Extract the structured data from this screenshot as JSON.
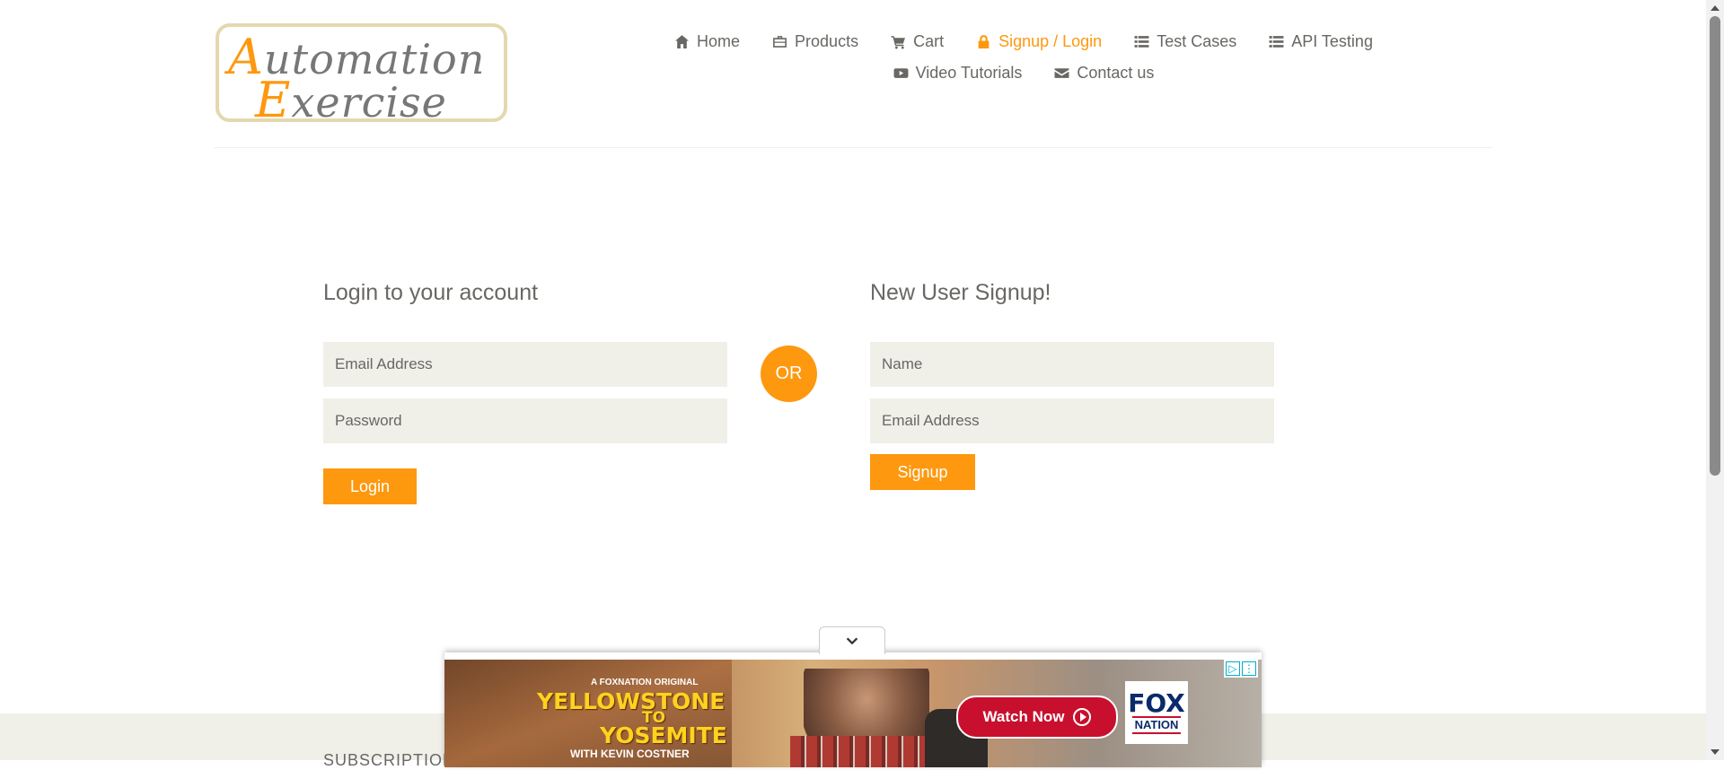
{
  "header": {
    "logo": {
      "line1_cap": "A",
      "line1_rest": "utomation",
      "line2_cap": "E",
      "line2_rest": "xercise"
    },
    "nav_row1": [
      {
        "label": "Home",
        "icon": "home-icon"
      },
      {
        "label": "Products",
        "icon": "products-icon"
      },
      {
        "label": "Cart",
        "icon": "cart-icon"
      },
      {
        "label": "Signup / Login",
        "icon": "lock-icon",
        "active": true
      },
      {
        "label": "Test Cases",
        "icon": "list-icon"
      },
      {
        "label": "API Testing",
        "icon": "list-icon"
      }
    ],
    "nav_row2": [
      {
        "label": "Video Tutorials",
        "icon": "youtube-icon"
      },
      {
        "label": "Contact us",
        "icon": "envelope-icon"
      }
    ]
  },
  "login": {
    "title": "Login to your account",
    "email_placeholder": "Email Address",
    "password_placeholder": "Password",
    "button": "Login"
  },
  "or_label": "OR",
  "signup": {
    "title": "New User Signup!",
    "name_placeholder": "Name",
    "email_placeholder": "Email Address",
    "button": "Signup"
  },
  "footer": {
    "subscription_label": "SUBSCRIPTION"
  },
  "ad": {
    "kicker": "A FOXNATION ORIGINAL",
    "title_line1": "YELLOWSTONE",
    "title_line2": "TO",
    "title_line3": "YOSEMITE",
    "with": "WITH KEVIN COSTNER",
    "cta": "Watch Now",
    "brand_line1": "FOX",
    "brand_line2": "NATION"
  },
  "colors": {
    "accent": "#fe980f",
    "text": "#696763",
    "field_bg": "#f0f0e9"
  }
}
